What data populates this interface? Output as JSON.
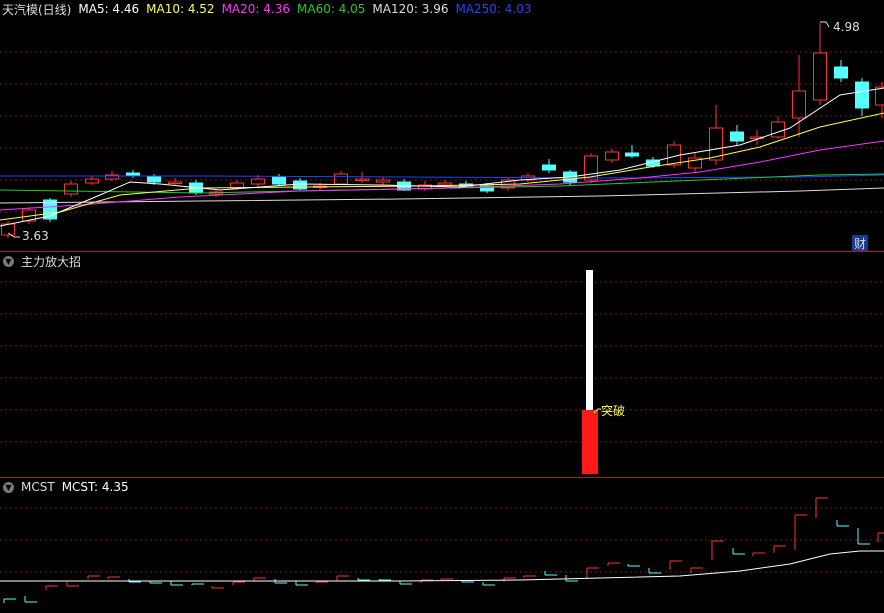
{
  "main_chart": {
    "title": "天汽模(日线)",
    "ma_legend": [
      {
        "label": "MA5: 4.46",
        "color": "#ffffff"
      },
      {
        "label": "MA10: 4.52",
        "color": "#ffff55"
      },
      {
        "label": "MA20: 4.36",
        "color": "#ff33ff"
      },
      {
        "label": "MA60: 4.05",
        "color": "#22cc22"
      },
      {
        "label": "MA120: 3.96",
        "color": "#dddddd"
      },
      {
        "label": "MA250: 4.03",
        "color": "#2244ff"
      }
    ],
    "high_marker": "4.98",
    "low_marker": "3.63",
    "corner_badge": "财"
  },
  "indicator_panel": {
    "title": "主力放大招",
    "signal_label": "突破"
  },
  "mcst_panel": {
    "name": "MCST",
    "value_label": "MCST: 4.35"
  },
  "colors": {
    "up": "#ff3333",
    "down": "#54ffff",
    "grid": "#7a1a1a",
    "divider": "#a0202a"
  },
  "icons": [
    "chevron-down-icon"
  ]
}
